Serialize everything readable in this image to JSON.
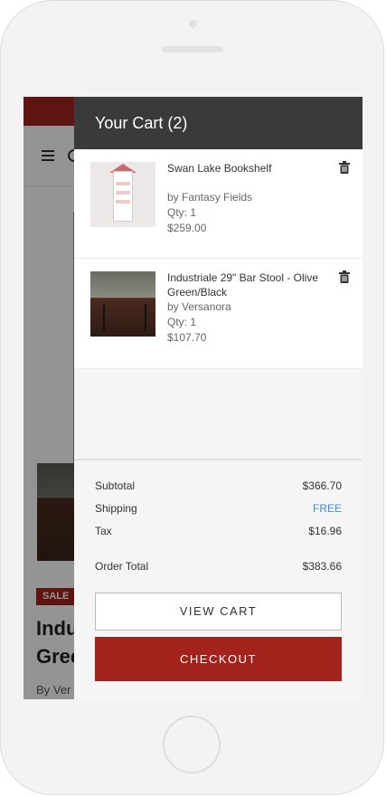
{
  "background_page": {
    "sale_badge": "SALE",
    "title_line1": "Indu",
    "title_line2": "Gree",
    "by_text": "By Ver"
  },
  "cart": {
    "title": "Your Cart (2)",
    "items": [
      {
        "name": "Swan Lake Bookshelf",
        "brand": "by Fantasy Fields",
        "qty": "Qty: 1",
        "price": "$259.00",
        "image": "bookshelf-image"
      },
      {
        "name": "Industriale 29\" Bar Stool - Olive Green/Black",
        "brand": "by Versanora",
        "qty": "Qty: 1",
        "price": "$107.70",
        "image": "bar-stool-image"
      }
    ],
    "summary": {
      "subtotal_label": "Subtotal",
      "subtotal_value": "$366.70",
      "shipping_label": "Shipping",
      "shipping_value": "FREE",
      "tax_label": "Tax",
      "tax_value": "$16.96",
      "total_label": "Order Total",
      "total_value": "$383.66"
    },
    "view_cart_label": "VIEW CART",
    "checkout_label": "CHECKOUT"
  },
  "colors": {
    "brand_red": "#a3231c",
    "header_dark": "#3a3a3a",
    "free_blue": "#3a8fd8"
  },
  "icons": [
    "hamburger-icon",
    "search-icon",
    "trash-icon"
  ]
}
